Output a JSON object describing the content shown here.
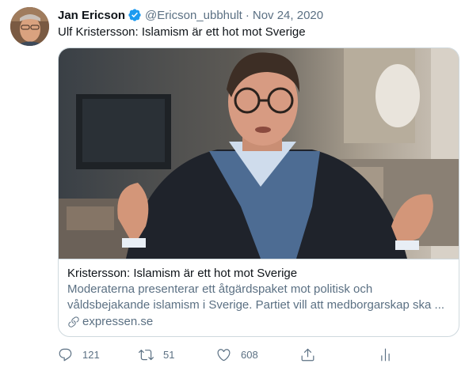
{
  "user": {
    "display_name": "Jan Ericson",
    "handle": "@Ericson_ubbhult",
    "separator": "·",
    "date": "Nov 24, 2020",
    "verified": true
  },
  "tweet": {
    "text": "Ulf Kristersson: Islamism är ett hot mot Sverige"
  },
  "card": {
    "title": "Kristersson: Islamism är ett hot mot Sverige",
    "description": "Moderaterna presenterar ett åtgärdspaket mot politisk och våldsbejakande islamism i Sverige. Partiet vill att medborgarskap ska ...",
    "domain": "expressen.se",
    "image_icon": "news-photo-image"
  },
  "actions": {
    "reply_count": "121",
    "retweet_count": "51",
    "like_count": "608",
    "icons": [
      "reply-icon",
      "retweet-icon",
      "like-icon",
      "share-icon",
      "analytics-icon"
    ]
  },
  "colors": {
    "text_primary": "#0f1419",
    "text_secondary": "#5b7083",
    "verified_blue": "#1d9bf0",
    "border": "#cfd9de"
  }
}
